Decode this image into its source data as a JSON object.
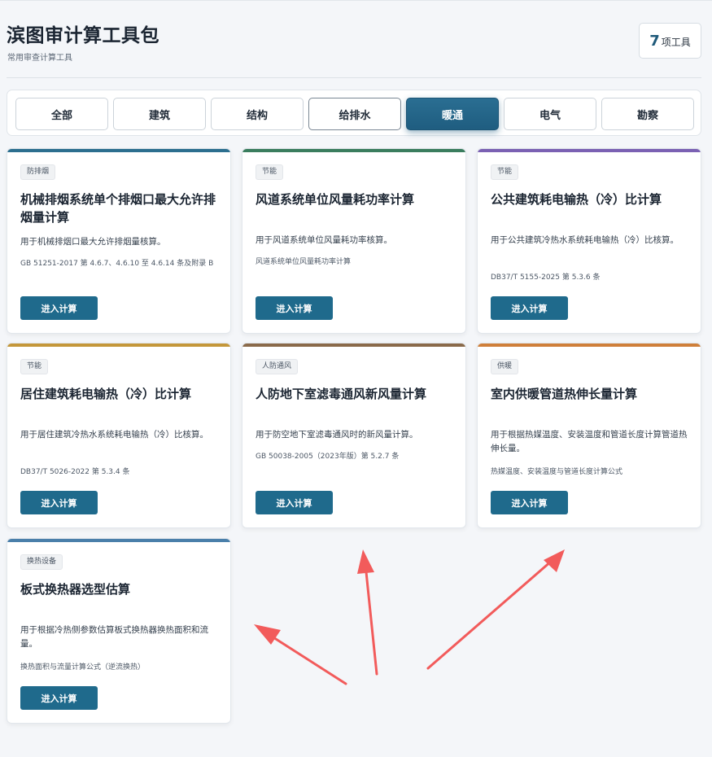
{
  "header": {
    "title": "滨图审计算工具包",
    "subtitle": "常用审查计算工具",
    "tool_count": "7",
    "tool_count_unit": "项工具"
  },
  "filters": [
    {
      "label": "全部",
      "state": "normal"
    },
    {
      "label": "建筑",
      "state": "normal"
    },
    {
      "label": "结构",
      "state": "normal"
    },
    {
      "label": "给排水",
      "state": "outlined"
    },
    {
      "label": "暖通",
      "state": "active"
    },
    {
      "label": "电气",
      "state": "normal"
    },
    {
      "label": "勘察",
      "state": "normal"
    }
  ],
  "enter_label": "进入计算",
  "cards": [
    {
      "tag": "防排烟",
      "title": "机械排烟系统单个排烟口最大允许排烟量计算",
      "desc": "用于机械排烟口最大允许排烟量核算。",
      "ref": "GB 51251-2017 第 4.6.7、4.6.10 至 4.6.14 条及附录 B",
      "accent": "#2c6f8f"
    },
    {
      "tag": "节能",
      "title": "风道系统单位风量耗功率计算",
      "desc": "用于风道系统单位风量耗功率核算。",
      "ref": "风道系统单位风量耗功率计算",
      "accent": "#3a7d5e"
    },
    {
      "tag": "节能",
      "title": "公共建筑耗电输热（冷）比计算",
      "desc": "用于公共建筑冷热水系统耗电输热（冷）比核算。",
      "ref": "DB37/T 5155-2025 第 5.3.6 条",
      "accent": "#7b61b3"
    },
    {
      "tag": "节能",
      "title": "居住建筑耗电输热（冷）比计算",
      "desc": "用于居住建筑冷热水系统耗电输热（冷）比核算。",
      "ref": "DB37/T 5026-2022 第 5.3.4 条",
      "accent": "#c4973a"
    },
    {
      "tag": "人防通风",
      "title": "人防地下室滤毒通风新风量计算",
      "desc": "用于防空地下室滤毒通风时的新风量计算。",
      "ref": "GB 50038-2005（2023年版）第 5.2.7 条",
      "accent": "#8a6a4a"
    },
    {
      "tag": "供暖",
      "title": "室内供暖管道热伸长量计算",
      "desc": "用于根据热媒温度、安装温度和管道长度计算管道热伸长量。",
      "ref": "热媒温度、安装温度与管道长度计算公式",
      "accent": "#cf7f3a"
    },
    {
      "tag": "换热设备",
      "title": "板式换热器选型估算",
      "desc": "用于根据冷热侧参数估算板式换热器换热面积和流量。",
      "ref": "换热面积与流量计算公式（逆流换热）",
      "accent": "#4a7faa"
    }
  ],
  "colors": {
    "arrow": "#f25b5b",
    "primary": "#1f6a8c"
  }
}
